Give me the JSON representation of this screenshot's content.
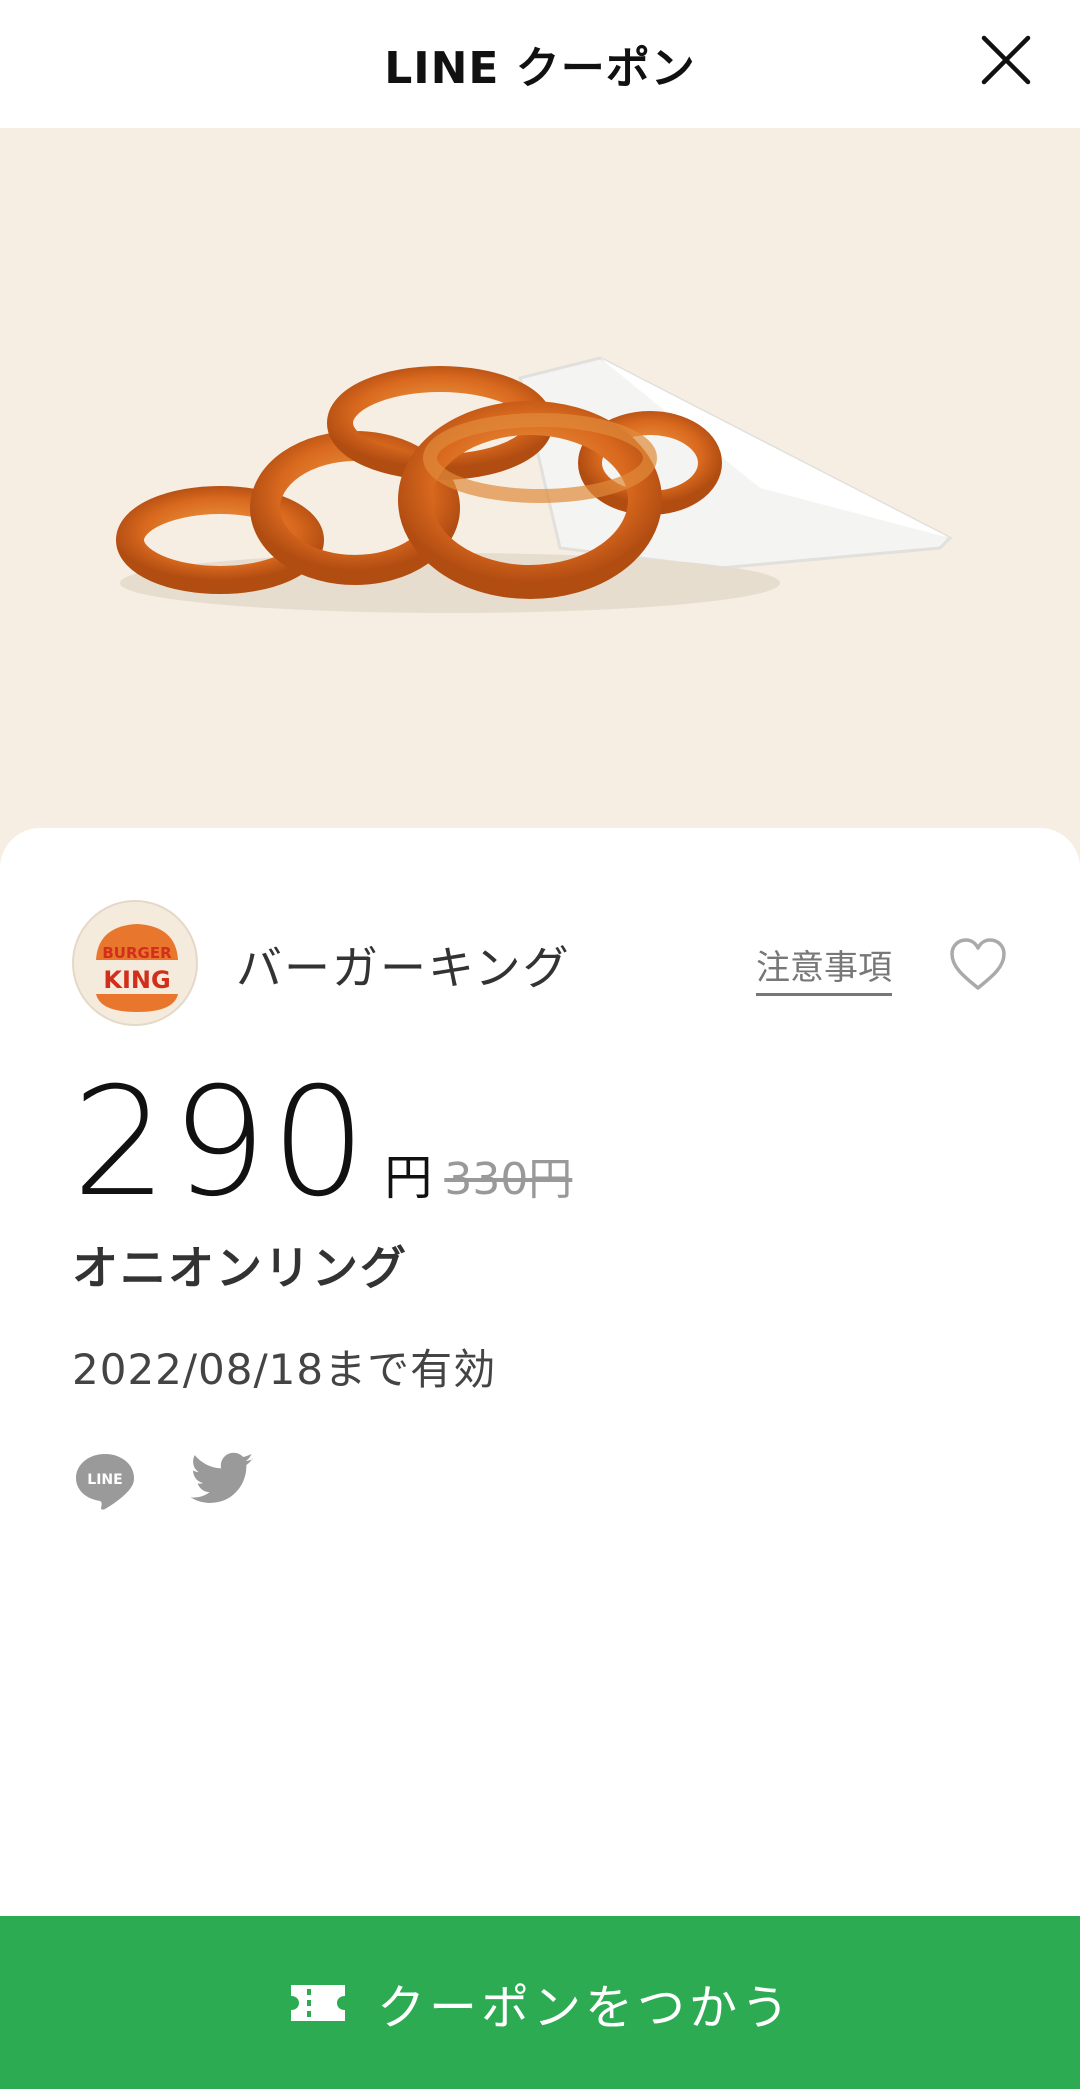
{
  "header": {
    "title": "LINE クーポン",
    "close_icon": "close-icon"
  },
  "hero": {
    "image": "onion-rings-photo",
    "background": "#f6eee3"
  },
  "brand": {
    "logo_text_top": "BURGER",
    "logo_text_bottom": "KING",
    "name": "バーガーキング"
  },
  "notes_link": "注意事項",
  "favorite_icon": "heart-outline-icon",
  "price": {
    "value": "290",
    "unit": "円",
    "original": "330円"
  },
  "product_name": "オニオンリング",
  "validity": "2022/08/18まで有効",
  "share": {
    "line_icon_text": "LINE",
    "icons": [
      "line-share-icon",
      "twitter-share-icon"
    ]
  },
  "use_button": {
    "label": "クーポンをつかう",
    "icon": "ticket-icon",
    "color": "#2cab52"
  }
}
